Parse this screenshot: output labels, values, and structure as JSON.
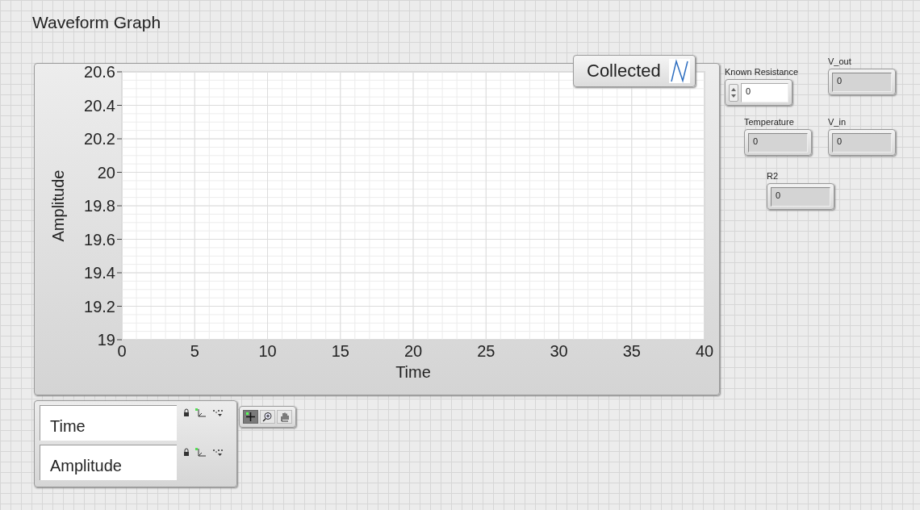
{
  "graph": {
    "title": "Waveform Graph",
    "legend": {
      "name": "Collected",
      "color": "#2f6fc0"
    },
    "chart_data": {
      "type": "line",
      "grid": true,
      "xlabel": "Time",
      "ylabel": "Amplitude",
      "xlim": [
        0,
        40
      ],
      "ylim": [
        19,
        20.6
      ],
      "xticks": [
        0,
        5,
        10,
        15,
        20,
        25,
        30,
        35,
        40
      ],
      "yticks": [
        19,
        19.2,
        19.4,
        19.6,
        19.8,
        20,
        20.2,
        20.4,
        20.6
      ]
    }
  },
  "scale_legend": [
    {
      "name": "Time"
    },
    {
      "name": "Amplitude"
    }
  ],
  "palette": [
    {
      "kind": "cursor",
      "selected": true
    },
    {
      "kind": "zoom",
      "selected": false
    },
    {
      "kind": "pan",
      "selected": false
    }
  ],
  "controls": [
    {
      "label": "Known Resistance",
      "value": "0",
      "kind": "control"
    },
    {
      "label": "V_out",
      "value": "0",
      "kind": "indicator"
    },
    {
      "label": "Temperature",
      "value": "0",
      "kind": "indicator"
    },
    {
      "label": "V_in",
      "value": "0",
      "kind": "indicator"
    },
    {
      "label": "R2",
      "value": "0",
      "kind": "indicator"
    }
  ]
}
